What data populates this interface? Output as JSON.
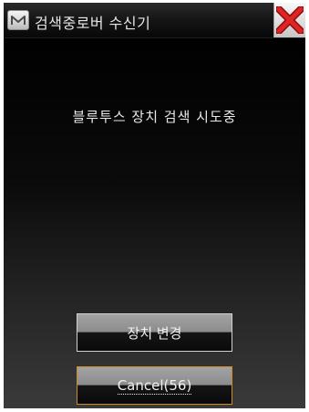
{
  "window": {
    "title": "검색중로버 수신기",
    "app_icon_letter": "M"
  },
  "status": {
    "message": "블루투스 장치 검색 시도중"
  },
  "buttons": {
    "change_device_label": "장치 변경",
    "cancel_label": "Cancel(56)"
  },
  "colors": {
    "background": "#000000",
    "title_text": "#e6e6e6",
    "cancel_border": "#d08a2a",
    "close_icon": "#d42020"
  },
  "icons": {
    "app": "m-logo-icon",
    "close": "close-x-icon"
  }
}
